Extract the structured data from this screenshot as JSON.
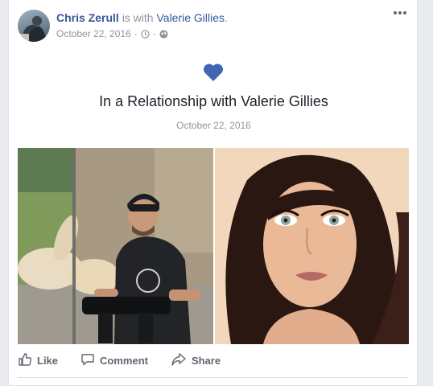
{
  "post": {
    "author": "Chris Zerull",
    "with_text": "is with",
    "tagged": "Valerie Gillies",
    "trailing": ".",
    "date": "October 22, 2016",
    "meta_separator": "·",
    "icons": [
      "clock-icon",
      "globe-icon",
      "more-options-icon"
    ]
  },
  "life_event": {
    "icon": "heart-icon",
    "title": "In a Relationship with Valerie Gillies",
    "date": "October 22, 2016",
    "heart_color": "#4267b2"
  },
  "actions": [
    {
      "label": "Like",
      "icon": "like-thumb-icon"
    },
    {
      "label": "Comment",
      "icon": "comment-bubble-icon"
    },
    {
      "label": "Share",
      "icon": "share-arrow-icon"
    }
  ],
  "colors": {
    "link": "#365899",
    "meta": "#90949c",
    "text": "#1d2129",
    "action": "#606770",
    "background": "#e9ebee"
  }
}
